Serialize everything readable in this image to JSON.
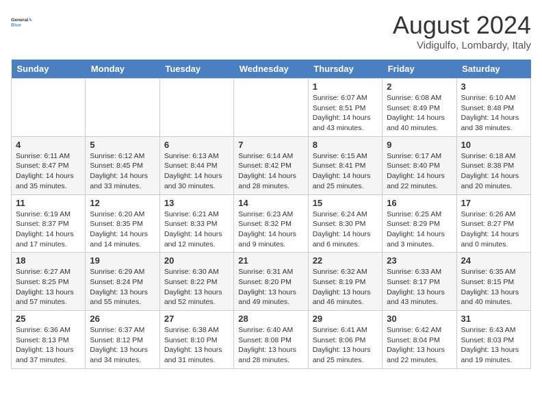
{
  "header": {
    "logo_line1": "General",
    "logo_line2": "Blue",
    "month_title": "August 2024",
    "location": "Vidigulfo, Lombardy, Italy"
  },
  "days_of_week": [
    "Sunday",
    "Monday",
    "Tuesday",
    "Wednesday",
    "Thursday",
    "Friday",
    "Saturday"
  ],
  "weeks": [
    [
      {
        "day": "",
        "info": ""
      },
      {
        "day": "",
        "info": ""
      },
      {
        "day": "",
        "info": ""
      },
      {
        "day": "",
        "info": ""
      },
      {
        "day": "1",
        "info": "Sunrise: 6:07 AM\nSunset: 8:51 PM\nDaylight: 14 hours\nand 43 minutes."
      },
      {
        "day": "2",
        "info": "Sunrise: 6:08 AM\nSunset: 8:49 PM\nDaylight: 14 hours\nand 40 minutes."
      },
      {
        "day": "3",
        "info": "Sunrise: 6:10 AM\nSunset: 8:48 PM\nDaylight: 14 hours\nand 38 minutes."
      }
    ],
    [
      {
        "day": "4",
        "info": "Sunrise: 6:11 AM\nSunset: 8:47 PM\nDaylight: 14 hours\nand 35 minutes."
      },
      {
        "day": "5",
        "info": "Sunrise: 6:12 AM\nSunset: 8:45 PM\nDaylight: 14 hours\nand 33 minutes."
      },
      {
        "day": "6",
        "info": "Sunrise: 6:13 AM\nSunset: 8:44 PM\nDaylight: 14 hours\nand 30 minutes."
      },
      {
        "day": "7",
        "info": "Sunrise: 6:14 AM\nSunset: 8:42 PM\nDaylight: 14 hours\nand 28 minutes."
      },
      {
        "day": "8",
        "info": "Sunrise: 6:15 AM\nSunset: 8:41 PM\nDaylight: 14 hours\nand 25 minutes."
      },
      {
        "day": "9",
        "info": "Sunrise: 6:17 AM\nSunset: 8:40 PM\nDaylight: 14 hours\nand 22 minutes."
      },
      {
        "day": "10",
        "info": "Sunrise: 6:18 AM\nSunset: 8:38 PM\nDaylight: 14 hours\nand 20 minutes."
      }
    ],
    [
      {
        "day": "11",
        "info": "Sunrise: 6:19 AM\nSunset: 8:37 PM\nDaylight: 14 hours\nand 17 minutes."
      },
      {
        "day": "12",
        "info": "Sunrise: 6:20 AM\nSunset: 8:35 PM\nDaylight: 14 hours\nand 14 minutes."
      },
      {
        "day": "13",
        "info": "Sunrise: 6:21 AM\nSunset: 8:33 PM\nDaylight: 14 hours\nand 12 minutes."
      },
      {
        "day": "14",
        "info": "Sunrise: 6:23 AM\nSunset: 8:32 PM\nDaylight: 14 hours\nand 9 minutes."
      },
      {
        "day": "15",
        "info": "Sunrise: 6:24 AM\nSunset: 8:30 PM\nDaylight: 14 hours\nand 6 minutes."
      },
      {
        "day": "16",
        "info": "Sunrise: 6:25 AM\nSunset: 8:29 PM\nDaylight: 14 hours\nand 3 minutes."
      },
      {
        "day": "17",
        "info": "Sunrise: 6:26 AM\nSunset: 8:27 PM\nDaylight: 14 hours\nand 0 minutes."
      }
    ],
    [
      {
        "day": "18",
        "info": "Sunrise: 6:27 AM\nSunset: 8:25 PM\nDaylight: 13 hours\nand 57 minutes."
      },
      {
        "day": "19",
        "info": "Sunrise: 6:29 AM\nSunset: 8:24 PM\nDaylight: 13 hours\nand 55 minutes."
      },
      {
        "day": "20",
        "info": "Sunrise: 6:30 AM\nSunset: 8:22 PM\nDaylight: 13 hours\nand 52 minutes."
      },
      {
        "day": "21",
        "info": "Sunrise: 6:31 AM\nSunset: 8:20 PM\nDaylight: 13 hours\nand 49 minutes."
      },
      {
        "day": "22",
        "info": "Sunrise: 6:32 AM\nSunset: 8:19 PM\nDaylight: 13 hours\nand 46 minutes."
      },
      {
        "day": "23",
        "info": "Sunrise: 6:33 AM\nSunset: 8:17 PM\nDaylight: 13 hours\nand 43 minutes."
      },
      {
        "day": "24",
        "info": "Sunrise: 6:35 AM\nSunset: 8:15 PM\nDaylight: 13 hours\nand 40 minutes."
      }
    ],
    [
      {
        "day": "25",
        "info": "Sunrise: 6:36 AM\nSunset: 8:13 PM\nDaylight: 13 hours\nand 37 minutes."
      },
      {
        "day": "26",
        "info": "Sunrise: 6:37 AM\nSunset: 8:12 PM\nDaylight: 13 hours\nand 34 minutes."
      },
      {
        "day": "27",
        "info": "Sunrise: 6:38 AM\nSunset: 8:10 PM\nDaylight: 13 hours\nand 31 minutes."
      },
      {
        "day": "28",
        "info": "Sunrise: 6:40 AM\nSunset: 8:08 PM\nDaylight: 13 hours\nand 28 minutes."
      },
      {
        "day": "29",
        "info": "Sunrise: 6:41 AM\nSunset: 8:06 PM\nDaylight: 13 hours\nand 25 minutes."
      },
      {
        "day": "30",
        "info": "Sunrise: 6:42 AM\nSunset: 8:04 PM\nDaylight: 13 hours\nand 22 minutes."
      },
      {
        "day": "31",
        "info": "Sunrise: 6:43 AM\nSunset: 8:03 PM\nDaylight: 13 hours\nand 19 minutes."
      }
    ]
  ]
}
